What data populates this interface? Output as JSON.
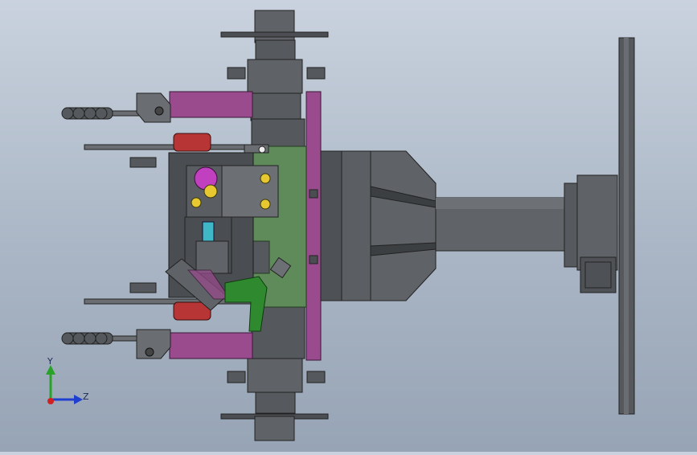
{
  "viewport": {
    "background_top": "#c9d2de",
    "background_bottom": "#97a4b5"
  },
  "triad": {
    "y_label": "Y",
    "z_label": "Z",
    "y_color": "#2aa22a",
    "z_color": "#1f3fd0",
    "x_color": "#d02020"
  },
  "colors": {
    "steel": "#5f6266",
    "steel_dark": "#3e4144",
    "steel_light": "#7a7d82",
    "plate_green": "#5f8a5a",
    "magenta": "#9a4b8e",
    "bright_magenta": "#c040c0",
    "rubber_red": "#b73535",
    "bright_green": "#2f8a2f",
    "cyan": "#3fb7c7"
  }
}
